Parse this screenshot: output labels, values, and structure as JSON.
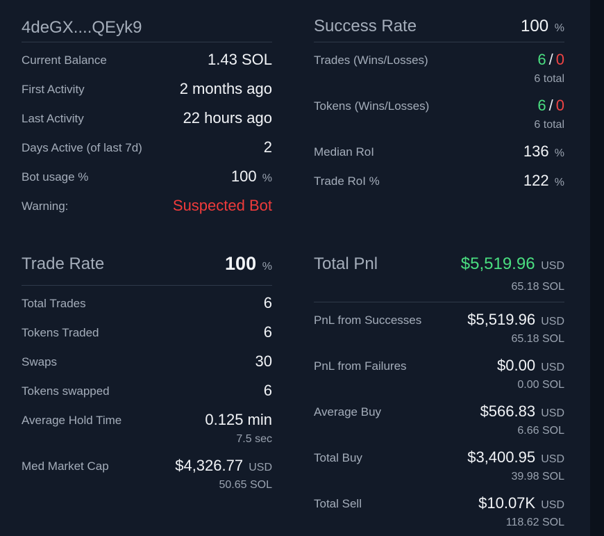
{
  "wallet": {
    "address": "4deGX....QEyk9",
    "rows": [
      {
        "label": "Current Balance",
        "value": "1.43 SOL",
        "unit": ""
      },
      {
        "label": "First Activity",
        "value": "2 months ago",
        "unit": ""
      },
      {
        "label": "Last Activity",
        "value": "22 hours ago",
        "unit": ""
      },
      {
        "label": "Days Active (of last 7d)",
        "value": "2",
        "unit": ""
      },
      {
        "label": "Bot usage %",
        "value": "100",
        "unit": "%"
      },
      {
        "label": "Warning:",
        "value": "Suspected Bot",
        "unit": ""
      }
    ]
  },
  "success": {
    "title": "Success Rate",
    "value": "100",
    "unit": "%",
    "trades": {
      "label": "Trades (Wins/Losses)",
      "wins": "6",
      "sep": "/",
      "losses": "0",
      "total": "6 total"
    },
    "tokens": {
      "label": "Tokens (Wins/Losses)",
      "wins": "6",
      "sep": "/",
      "losses": "0",
      "total": "6 total"
    },
    "median_roi": {
      "label": "Median RoI",
      "value": "136",
      "unit": "%"
    },
    "trade_roi": {
      "label": "Trade RoI %",
      "value": "122",
      "unit": "%"
    }
  },
  "trade_rate": {
    "title": "Trade Rate",
    "value": "100",
    "unit": "%",
    "rows": [
      {
        "label": "Total Trades",
        "value": "6"
      },
      {
        "label": "Tokens Traded",
        "value": "6"
      },
      {
        "label": "Swaps",
        "value": "30"
      },
      {
        "label": "Tokens swapped",
        "value": "6"
      }
    ],
    "hold_time": {
      "label": "Average Hold Time",
      "value": "0.125 min",
      "sub": "7.5 sec"
    },
    "med_market_cap": {
      "label": "Med Market Cap",
      "value": "$4,326.77",
      "unit": "USD",
      "sub": "50.65 SOL"
    }
  },
  "pnl": {
    "title": "Total Pnl",
    "value": "$5,519.96",
    "unit": "USD",
    "sub": "65.18 SOL",
    "rows": [
      {
        "label": "PnL from Successes",
        "value": "$5,519.96",
        "unit": "USD",
        "sub": "65.18 SOL"
      },
      {
        "label": "PnL from Failures",
        "value": "$0.00",
        "unit": "USD",
        "sub": "0.00 SOL"
      },
      {
        "label": "Average Buy",
        "value": "$566.83",
        "unit": "USD",
        "sub": "6.66 SOL"
      },
      {
        "label": "Total Buy",
        "value": "$3,400.95",
        "unit": "USD",
        "sub": "39.98 SOL"
      },
      {
        "label": "Total Sell",
        "value": "$10.07K",
        "unit": "USD",
        "sub": "118.62 SOL"
      }
    ]
  },
  "colors": {
    "accent": "#3b82f6",
    "win": "#4ade80",
    "loss": "#ef4444",
    "background": "#121a28"
  }
}
